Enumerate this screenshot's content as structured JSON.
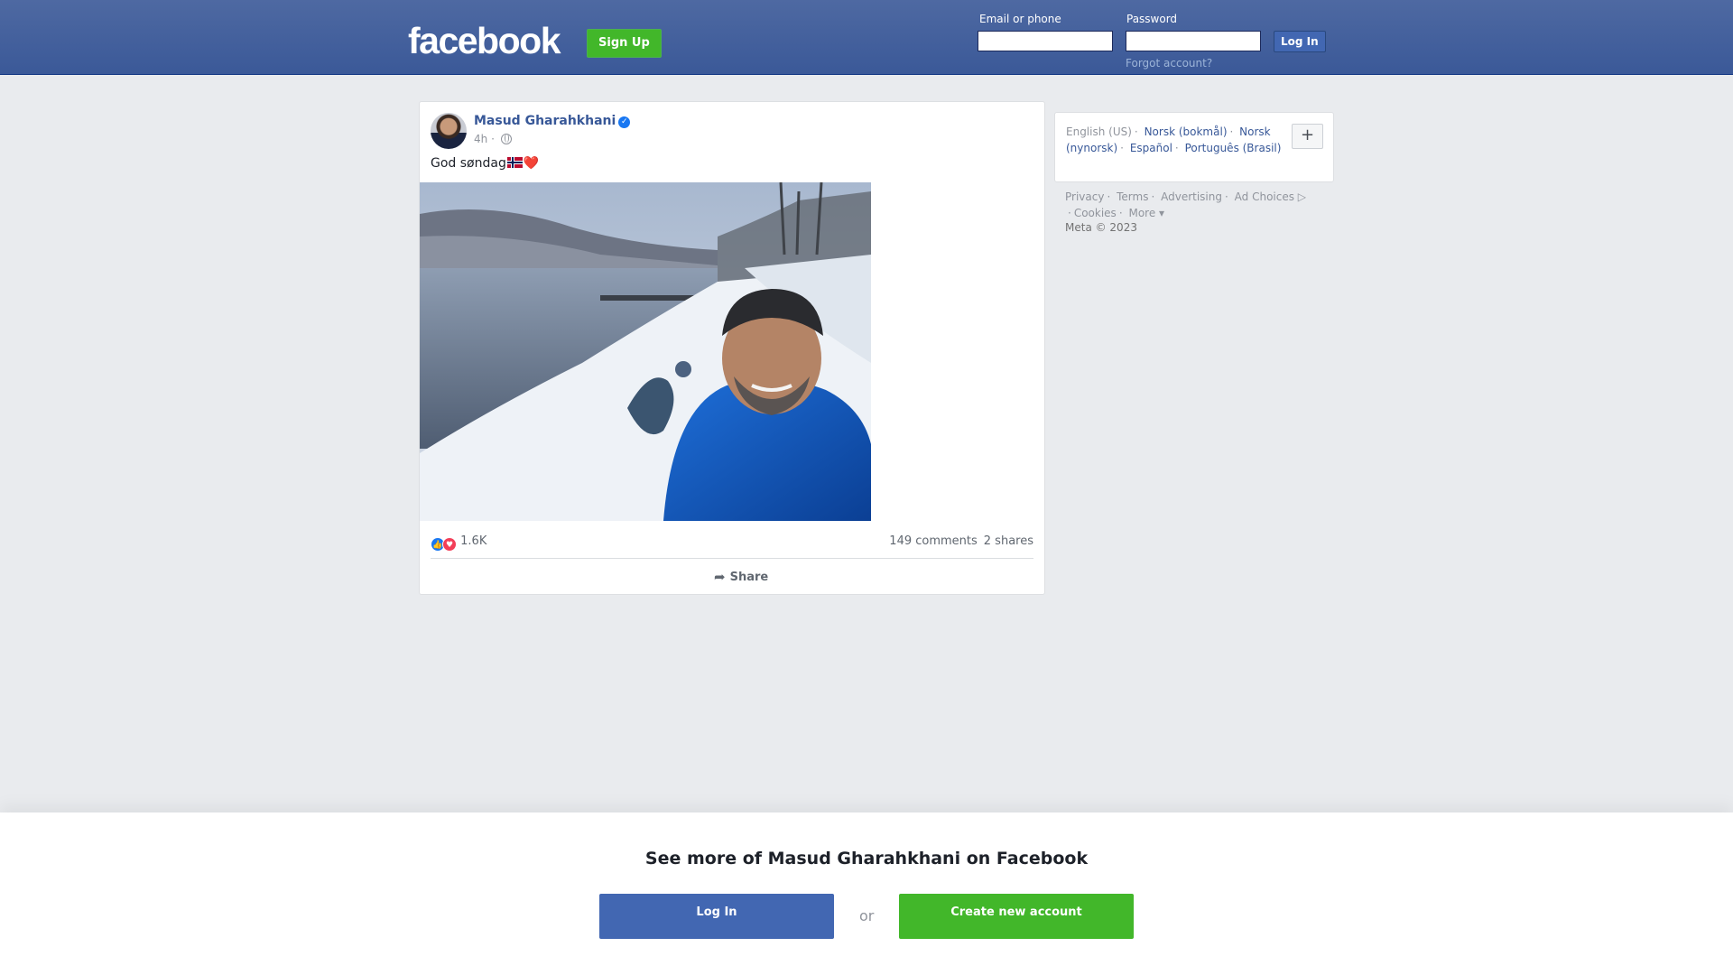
{
  "header": {
    "logo_text": "facebook",
    "signup_label": "Sign Up",
    "email_label": "Email or phone",
    "email_value": "",
    "password_label": "Password",
    "password_value": "",
    "login_label": "Log In",
    "forgot_label": "Forgot account?"
  },
  "post": {
    "author": "Masud Gharahkhani",
    "verified": true,
    "time": "4h",
    "separator": "·",
    "audience_icon": "globe-icon",
    "text": "God søndag",
    "emoji_flag": "norway-flag",
    "emoji_heart": "❤️",
    "photo_description_icon": "photo",
    "reaction_icons": [
      "like-icon",
      "love-icon"
    ],
    "reactions_count": "1.6K",
    "comments": "149 comments",
    "shares": "2 shares",
    "share_label": "Share"
  },
  "sidebar": {
    "languages": [
      {
        "label": "English (US)",
        "current": true
      },
      {
        "label": "Norsk (bokmål)",
        "current": false
      },
      {
        "label": "Norsk (nynorsk)",
        "current": false
      },
      {
        "label": "Español",
        "current": false
      },
      {
        "label": "Português (Brasil)",
        "current": false
      }
    ],
    "more_languages_label": "+",
    "footer_links": [
      "Privacy",
      "Terms",
      "Advertising",
      "Ad Choices",
      "Cookies",
      "More"
    ],
    "copyright": "Meta © 2023"
  },
  "bottom_prompt": {
    "title": "See more of Masud Gharahkhani on Facebook",
    "login_label": "Log In",
    "or_label": "or",
    "create_label": "Create new account"
  },
  "colors": {
    "brand_blue": "#3b5998",
    "button_blue": "#4267b2",
    "green": "#42b72a",
    "background": "#e9ebee"
  }
}
